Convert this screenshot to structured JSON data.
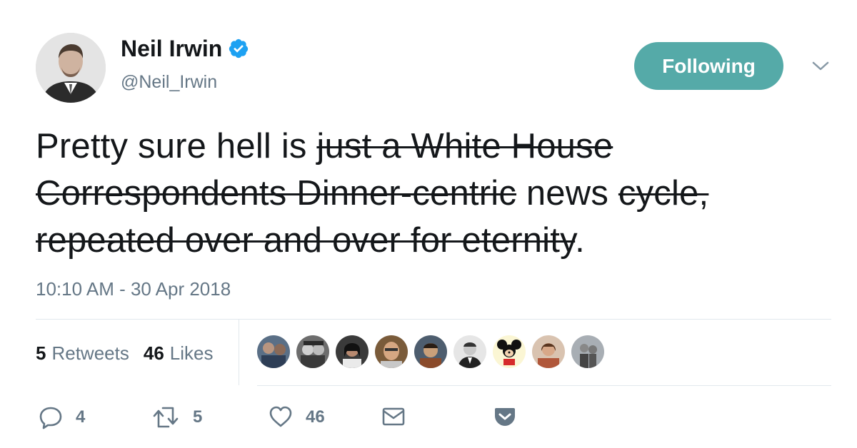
{
  "user": {
    "name": "Neil Irwin",
    "handle": "@Neil_Irwin",
    "verified_icon": "verified-badge-icon"
  },
  "follow_button_label": "Following",
  "menu_icon": "chevron-down-icon",
  "tweet": {
    "segments": [
      {
        "text": "Pretty sure hell is ",
        "struck": false
      },
      {
        "text": "just a White House Correspondents Dinner-centric",
        "struck": true
      },
      {
        "text": " news ",
        "struck": false
      },
      {
        "text": "cycle, repeated over and over for eternity",
        "struck": true
      },
      {
        "text": ".",
        "struck": false
      }
    ]
  },
  "timestamp": "10:10 AM - 30 Apr 2018",
  "stats": {
    "retweets_count": "5",
    "retweets_label": "Retweets",
    "likes_count": "46",
    "likes_label": "Likes"
  },
  "likers": [
    "liker-avatar-1",
    "liker-avatar-2",
    "liker-avatar-3",
    "liker-avatar-4",
    "liker-avatar-5",
    "liker-avatar-6",
    "liker-avatar-7",
    "liker-avatar-8",
    "liker-avatar-9"
  ],
  "actions": {
    "reply_count": "4",
    "retweet_count": "5",
    "like_count": "46"
  },
  "colors": {
    "accent": "#55aaa8",
    "verified": "#1da1f2",
    "text": "#14171a",
    "muted": "#657786"
  }
}
